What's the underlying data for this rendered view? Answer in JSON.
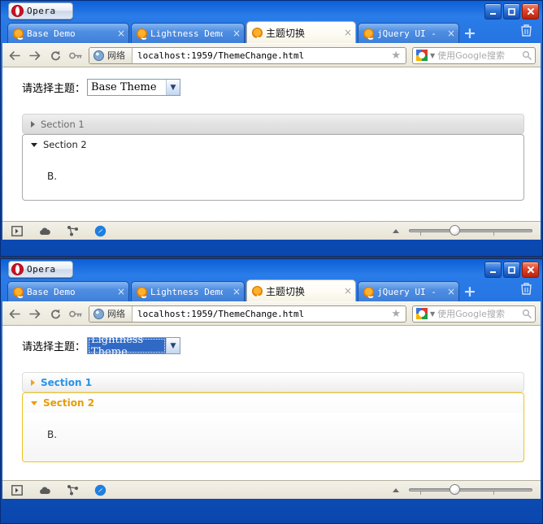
{
  "app": {
    "menu_button_label": "Opera",
    "logo_icon": "opera-logo-icon",
    "minimize_label": "_",
    "maximize_label": "□",
    "close_label": "×"
  },
  "tabs": [
    {
      "label": "Base Demo",
      "close": "×",
      "active": false
    },
    {
      "label": "Lightness Demo",
      "close": "×",
      "active": false
    },
    {
      "label": "主题切换",
      "close": "×",
      "active": true
    },
    {
      "label": "jQuery UI - ...",
      "close": "×",
      "active": false
    }
  ],
  "tabstrip": {
    "new_tab_label": "+",
    "new_tab_icon": "plus-icon",
    "trash_icon": "trash-icon"
  },
  "toolbar": {
    "back_icon": "arrow-left-icon",
    "forward_icon": "arrow-right-icon",
    "reload_icon": "reload-icon",
    "key_icon": "key-icon",
    "zone_icon": "globe-icon",
    "zone_label": "网络",
    "url": "localhost:1959/ThemeChange.html",
    "bookmark_icon": "star-icon",
    "search_engine_icon": "google-icon",
    "search_dropdown_icon": "chevron-down-icon",
    "search_placeholder": "使用Google搜索",
    "search_value": "",
    "search_icon": "magnifier-icon"
  },
  "page": {
    "select_label": "请选择主题：",
    "theme_options": [
      "Base Theme",
      "Lightness Theme"
    ],
    "accordion": {
      "section1_label": "Section 1",
      "section2_label": "Section 2",
      "section2_content": "B.",
      "collapsed_arrow_icon": "triangle-right-icon",
      "expanded_arrow_icon": "triangle-down-icon"
    }
  },
  "window_a": {
    "theme_selected": "Base Theme",
    "theme_focused": false
  },
  "window_b": {
    "theme_selected": "Lightness Theme",
    "theme_focused": true
  },
  "statusbar": {
    "panel_icon": "panel-toggle-icon",
    "cloud_icon": "cloud-icon",
    "unite_icon": "unite-share-icon",
    "turbo_icon": "opera-turbo-icon",
    "expand_icon": "triangle-up-icon",
    "zoom_slider_icon": "zoom-slider",
    "zoom_value": "100%"
  },
  "colors": {
    "window_chrome": "#1457c9",
    "active_tab_bg": "#fdfbf3",
    "toolbar_bg": "#eae7da",
    "lightness_link": "#2694e8",
    "lightness_active": "#e79c07",
    "lightness_border": "#f0c419",
    "base_header": "#e3e3e3",
    "select_focus": "#316ac5"
  }
}
